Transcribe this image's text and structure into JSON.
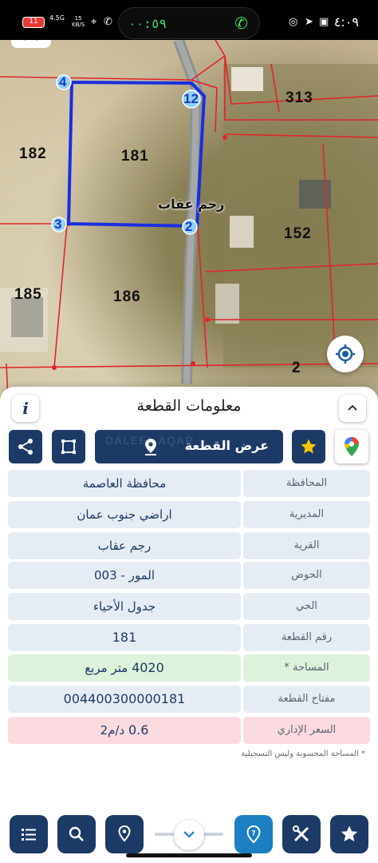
{
  "status_bar": {
    "battery": "11",
    "network": "4.5G",
    "speed_value": "15",
    "speed_unit": "KB/S",
    "call_timer": "٠٠:٥٩",
    "time": "٤:٠٩"
  },
  "map": {
    "parcels": [
      "313",
      "182",
      "181",
      "152",
      "185",
      "186",
      "2"
    ],
    "corner_points": [
      "4",
      "12",
      "3",
      "2"
    ],
    "road_name": "رجم عقاب"
  },
  "panel": {
    "title": "معلومات القطعة",
    "info_label": "i",
    "show_plot_label": "عرض القطعة",
    "watermark": "DALEEL AQAR",
    "rows": [
      {
        "label": "المحافظة",
        "value": "محافظة العاصمة"
      },
      {
        "label": "المديرية",
        "value": "اراضي جنوب عمان"
      },
      {
        "label": "القرية",
        "value": "رجم عقاب"
      },
      {
        "label": "الحوض",
        "value": "المور - 003"
      },
      {
        "label": "الحي",
        "value": "جدول الأحياء"
      },
      {
        "label": "رقم القطعة",
        "value": "181"
      },
      {
        "label": "المساحة *",
        "value_number": "4020",
        "value_unit": "متر مربع"
      },
      {
        "label": "مفتاح القطعة",
        "value": "004400300000181"
      },
      {
        "label": "السعر الإداري",
        "value_number": "0.6",
        "value_unit": "د/م2"
      }
    ],
    "footnote": "* المساحة المحسوبة وليس التسجيلية"
  },
  "colors": {
    "primary": "#1d3a66",
    "accent_blue": "#1b7fc1",
    "plot_outline": "#1a2ee0",
    "parcel_lines": "#e0242a",
    "star": "#f7c600",
    "area_row_bg": "#dcf2da",
    "price_row_bg": "#fbdbe0"
  },
  "icons": [
    "share-icon",
    "polygon-icon",
    "location-pin-icon",
    "star-icon",
    "google-maps-icon",
    "list-icon",
    "search-icon",
    "pin-icon",
    "chevron-down-icon",
    "help-pin-icon",
    "tools-icon",
    "star-outline-icon",
    "locate-icon",
    "chevron-up-icon"
  ]
}
